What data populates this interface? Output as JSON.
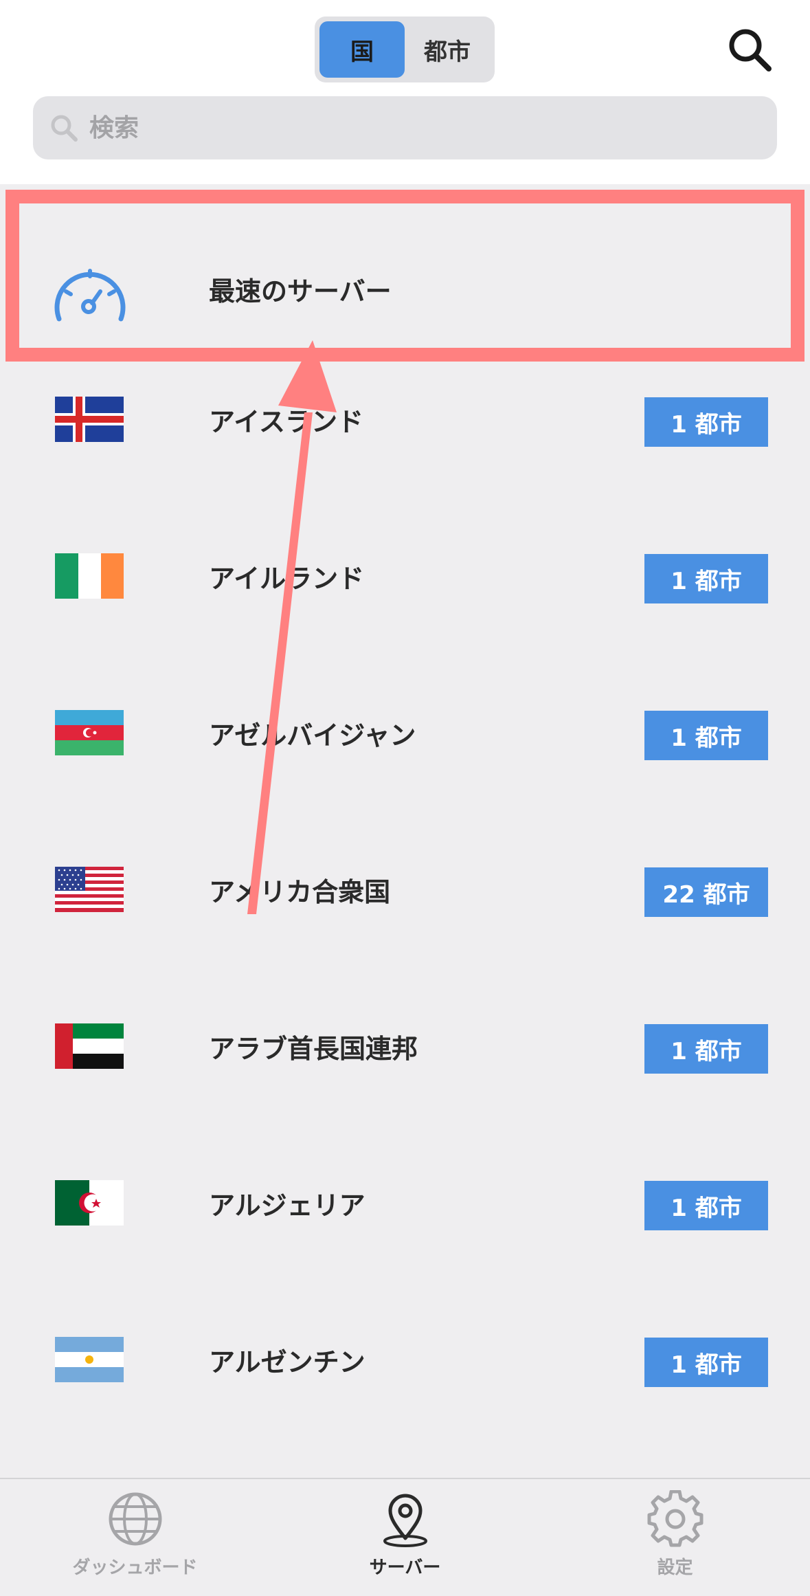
{
  "header": {
    "segments": [
      {
        "label": "国",
        "active": true
      },
      {
        "label": "都市",
        "active": false
      }
    ],
    "search_icon": "search-icon"
  },
  "search": {
    "placeholder": "検索"
  },
  "fastest": {
    "label": "最速のサーバー",
    "icon": "speedometer-icon"
  },
  "countries": [
    {
      "name": "アイスランド",
      "cities": "1 都市",
      "flag": "iceland-flag"
    },
    {
      "name": "アイルランド",
      "cities": "1 都市",
      "flag": "ireland-flag"
    },
    {
      "name": "アゼルバイジャン",
      "cities": "1 都市",
      "flag": "azerbaijan-flag"
    },
    {
      "name": "アメリカ合衆国",
      "cities": "22 都市",
      "flag": "usa-flag"
    },
    {
      "name": "アラブ首長国連邦",
      "cities": "1 都市",
      "flag": "uae-flag"
    },
    {
      "name": "アルジェリア",
      "cities": "1 都市",
      "flag": "algeria-flag"
    },
    {
      "name": "アルゼンチン",
      "cities": "1 都市",
      "flag": "argentina-flag"
    }
  ],
  "tabbar": {
    "tabs": [
      {
        "label": "ダッシュボード",
        "icon": "globe-icon",
        "active": false
      },
      {
        "label": "サーバー",
        "icon": "location-pin-icon",
        "active": true
      },
      {
        "label": "設定",
        "icon": "gear-icon",
        "active": false
      }
    ]
  },
  "colors": {
    "accent": "#4a90e2",
    "annotation": "#ff8080",
    "background": "#efeef0"
  }
}
